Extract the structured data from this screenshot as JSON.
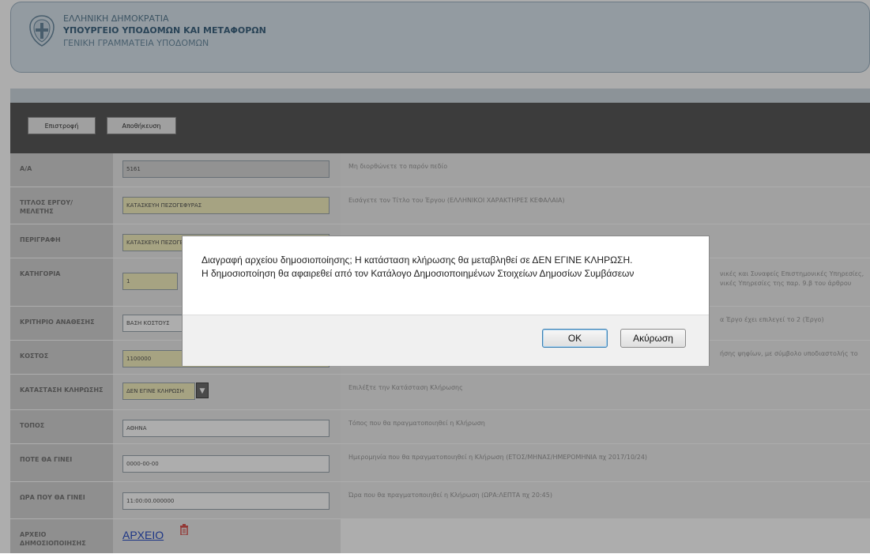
{
  "header": {
    "line1": "ΕΛΛΗΝΙΚΗ ΔΗΜΟΚΡΑΤΙΑ",
    "line2": "ΥΠΟΥΡΓΕΙΟ ΥΠΟΔΟΜΩΝ ΚΑΙ ΜΕΤΑΦΟΡΩΝ",
    "line3": "ΓΕΝΙΚΗ ΓΡΑΜΜΑΤΕΙΑ ΥΠΟΔΟΜΩΝ"
  },
  "toolbar": {
    "back_label": "Επιστροφή",
    "save_label": "Αποθήκευση"
  },
  "form": {
    "aa": {
      "label": "Α/Α",
      "value": "5161",
      "info": "Μη διορθώνετε το παρόν πεδίο"
    },
    "title": {
      "label": "ΤΙΤΛΟΣ ΕΡΓΟΥ/ ΜΕΛΕΤΗΣ",
      "value": "ΚΑΤΑΣΚΕΥΗ ΠΕΖΟΓΕΦΥΡΑΣ",
      "info": "Εισάγετε τον Τίτλο του Έργου (ΕΛΛΗΝΙΚΟΙ ΧΑΡΑΚΤΗΡΕΣ ΚΕΦΑΛΑΙΑ)"
    },
    "description": {
      "label": "ΠΕΡΙΓΡΑΦΗ",
      "value": "ΚΑΤΑΣΚΕΥΗ ΠΕΖΟΓΕΦΥΡΑΣ",
      "info": ""
    },
    "category": {
      "label": "ΚΑΤΗΓΟΡΙΑ",
      "value": "1",
      "info_line1": "νικές και Συναφείς Επιστημονικές Υπηρεσίες,",
      "info_line2": "νικές Υπηρεσίες της παρ. 9.β του άρθρου"
    },
    "criterion": {
      "label": "ΚΡΙΤΗΡΙΟ ΑΝΑΘΕΣΗΣ",
      "value": "ΒΑΣΗ ΚΟΣΤΟΥΣ",
      "info": "α Έργο έχει επιλεγεί το 2 (Έργο)"
    },
    "cost": {
      "label": "ΚΟΣΤΟΣ",
      "value": "1100000",
      "info": "ήσης ψηφίων, με σύμβολο υποδιαστολής το"
    },
    "lottery_status": {
      "label": "ΚΑΤΑΣΤΑΣΗ ΚΛΗΡΩΣΗΣ",
      "value": "ΔΕΝ ΕΓΙΝΕ ΚΛΗΡΩΣΗ",
      "info": "Επιλέξτε την Κατάσταση Κλήρωσης"
    },
    "place": {
      "label": "ΤΟΠΟΣ",
      "value": "ΑΘΗΝΑ",
      "info": "Τόπος που θα πραγματοποιηθεί η Κλήρωση"
    },
    "when": {
      "label": "ΠΟΤΕ ΘΑ ΓΙΝΕΙ",
      "value": "0000-00-00",
      "info": "Ημερομηνία που θα πραγματοποιηθεί η Κλήρωση (ΕΤΟΣ/ΜΗΝΑΣ/ΗΜΕΡΟΜΗΝΙΑ πχ 2017/10/24)"
    },
    "time": {
      "label": "ΩΡΑ ΠΟΥ ΘΑ ΓΙΝΕΙ",
      "value": "11:00:00.000000",
      "info": "Ώρα που θα πραγματοποιηθεί η Κλήρωση (ΩΡΑ:ΛΕΠΤΑ πχ 20:45)"
    },
    "file": {
      "label": "ΑΡΧΕΙΟ ΔΗΜΟΣΙΟΠΟΙΗΣΗΣ",
      "link": "ΑΡΧΕΙΟ"
    }
  },
  "dialog": {
    "line1": "Διαγραφή αρχείου δημοσιοποίησης; Η κατάσταση κλήρωσης θα μεταβληθεί σε ΔΕΝ ΕΓΙΝΕ ΚΛΗΡΩΣΗ.",
    "line2": "Η δημοσιοποίηση θα αφαιρεθεί από τον Κατάλογο Δημοσιοποιημένων Στοιχείων Δημοσίων Συμβάσεων",
    "ok_label": "OK",
    "cancel_label": "Ακύρωση"
  },
  "colors": {
    "header_bg": "#d9e5ee",
    "toolbar_bg": "#595959",
    "required_field": "#f5f1c0",
    "link": "#2a4fc6",
    "trash": "#d9534f"
  },
  "icons": [
    "greek-emblem-icon",
    "dropdown-arrow-icon",
    "trash-icon"
  ]
}
